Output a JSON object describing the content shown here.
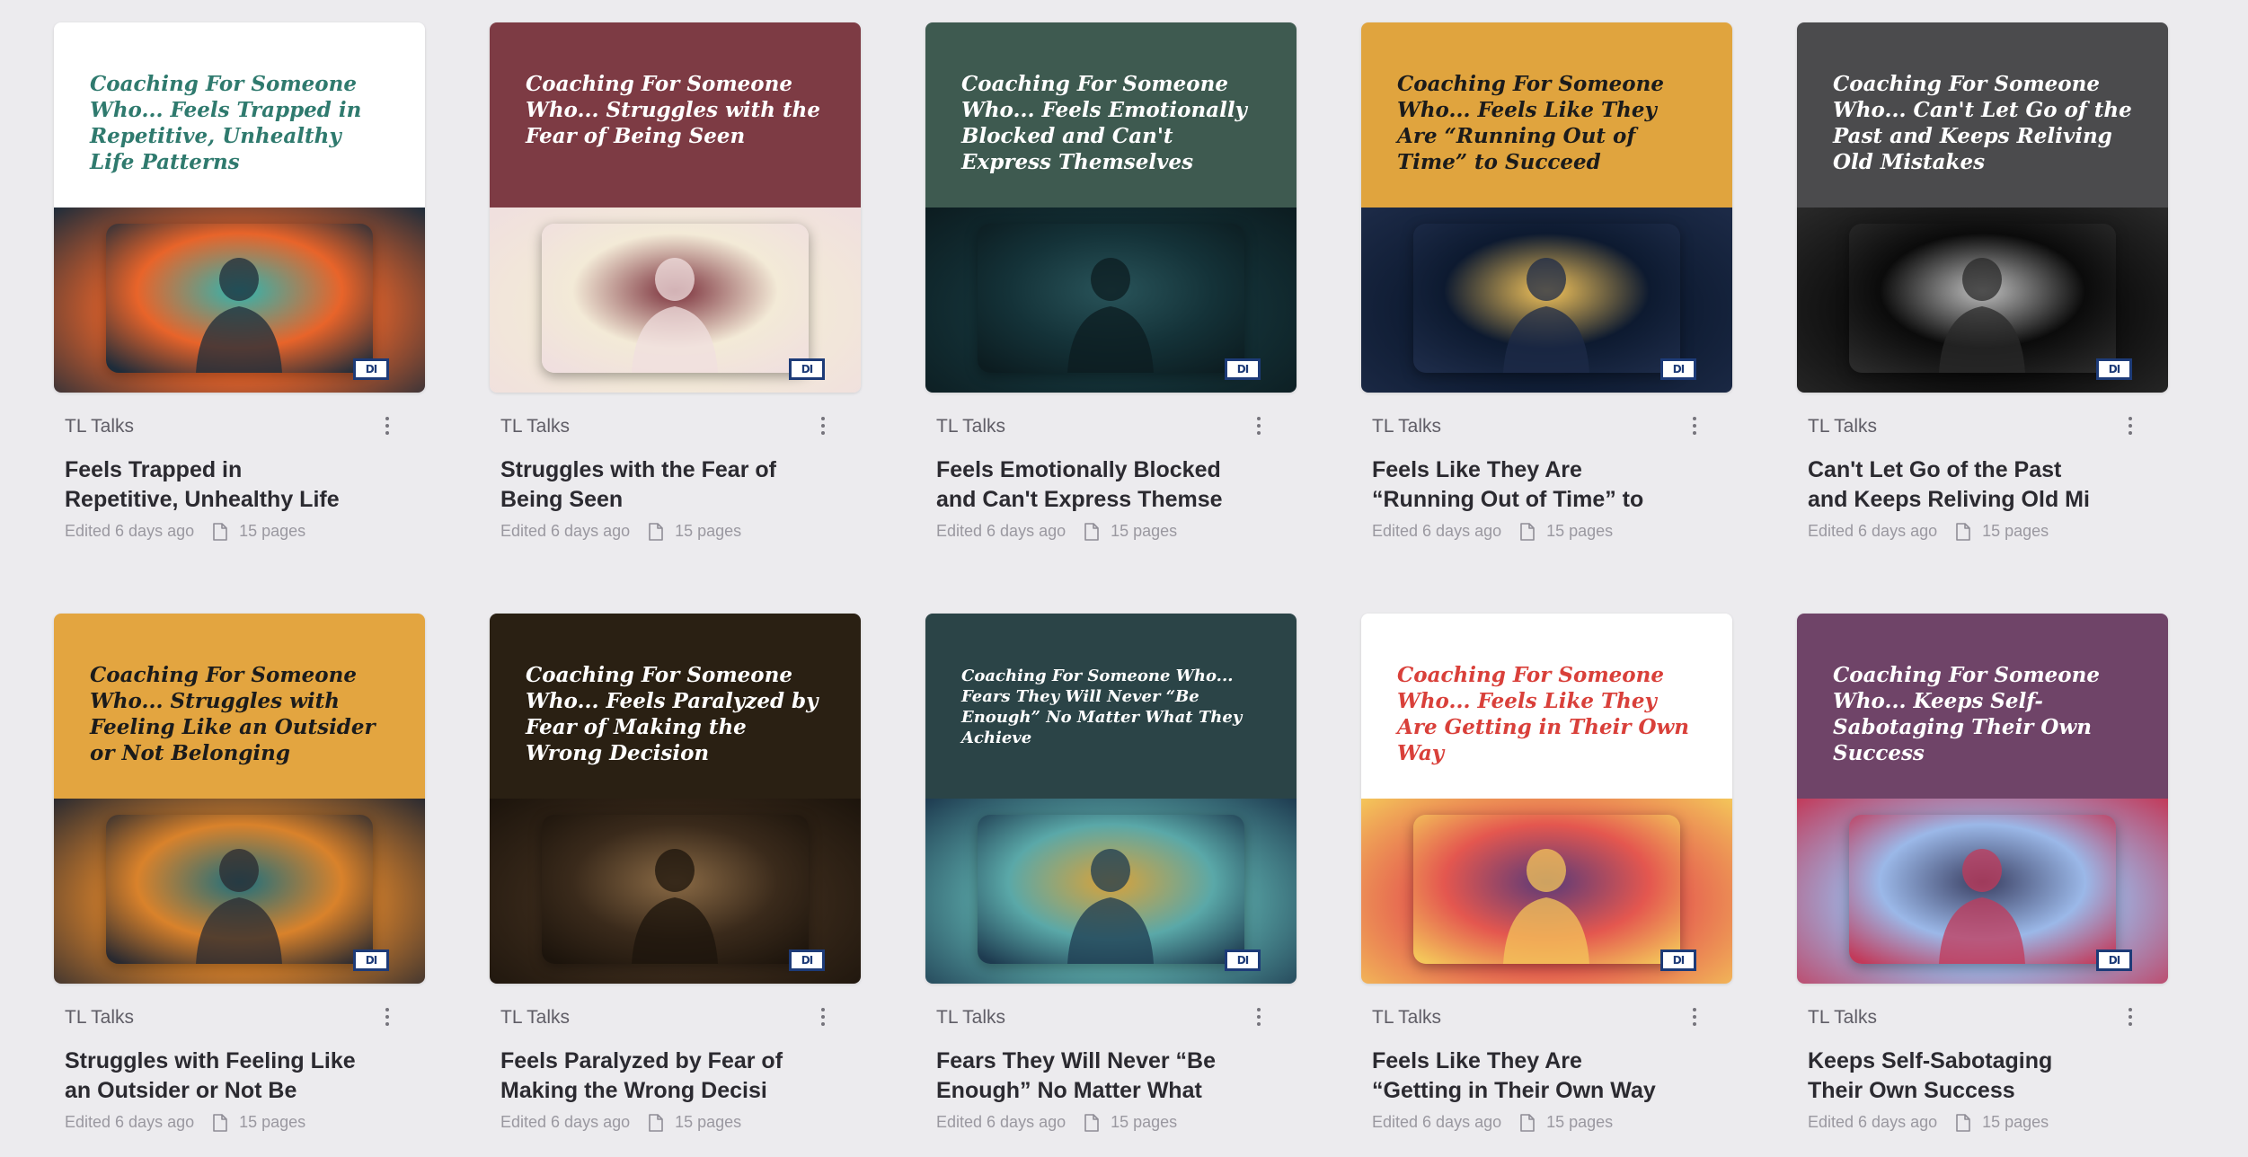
{
  "cards": [
    {
      "cover_text": "Coaching For Someone Who... Feels Trapped in Repetitive, Unhealthy Life Patterns",
      "cover_bg": "#ffffff",
      "cover_fg": "#2f7a6e",
      "art_colors": [
        "#e8642a",
        "#2fb5b0",
        "#1e2c3a"
      ],
      "art_icon": "boy-in-corridor-illustration",
      "logo_text": "DI",
      "channel": "TL Talks",
      "title": "Feels Trapped in Repetitive, Unhealthy Life Patter",
      "edited": "Edited 6 days ago",
      "pages": "15 pages"
    },
    {
      "cover_text": "Coaching For Someone Who... Struggles with the Fear of Being Seen",
      "cover_bg": "#7d3b44",
      "cover_fg": "#ffffff",
      "art_colors": [
        "#f3ead7",
        "#7a2f3a",
        "#f0dfdf"
      ],
      "art_icon": "stage-curtain-silhouette-illustration",
      "logo_text": "DI",
      "channel": "TL Talks",
      "title": "Struggles with the Fear of Being Seen",
      "edited": "Edited 6 days ago",
      "pages": "15 pages"
    },
    {
      "cover_text": "Coaching For Someone Who... Feels Emotionally Blocked and Can't Express Themselves",
      "cover_bg": "#3e5a50",
      "cover_fg": "#ffffff",
      "art_colors": [
        "#143238",
        "#29545a",
        "#0c1c20"
      ],
      "art_icon": "person-covering-face-photo",
      "logo_text": "DI",
      "channel": "TL Talks",
      "title": "Feels Emotionally Blocked and Can't Express Themse",
      "edited": "Edited 6 days ago",
      "pages": "15 pages"
    },
    {
      "cover_text": "Coaching For Someone Who... Feels Like They Are “Running Out of Time” to Succeed",
      "cover_bg": "#e0a43e",
      "cover_fg": "#1b1b1b",
      "art_colors": [
        "#0d1a30",
        "#f4c45a",
        "#1d2b48"
      ],
      "art_icon": "hourglass-door-illustration",
      "logo_text": "DI",
      "channel": "TL Talks",
      "title": "Feels Like They Are “Running Out of Time” to Succe",
      "edited": "Edited 6 days ago",
      "pages": "15 pages"
    },
    {
      "cover_text": "Coaching For Someone Who... Can't Let Go of the Past and Keeps Reliving Old Mistakes",
      "cover_bg": "#4b4b4d",
      "cover_fg": "#ffffff",
      "art_colors": [
        "#0b0b0b",
        "#bfbfbf",
        "#2a2a2a"
      ],
      "art_icon": "young-and-old-faces-photo",
      "logo_text": "DI",
      "channel": "TL Talks",
      "title": "Can't Let Go of the Past and Keeps Reliving Old Mi",
      "edited": "Edited 6 days ago",
      "pages": "15 pages"
    },
    {
      "cover_text": "Coaching For Someone Who... Struggles with Feeling Like an Outsider or Not Belonging",
      "cover_bg": "#e3a540",
      "cover_fg": "#1b1b1b",
      "art_colors": [
        "#d9822b",
        "#1d6f7e",
        "#2a2a30"
      ],
      "art_icon": "two-people-street-photo",
      "logo_text": "DI",
      "channel": "TL Talks",
      "title": "Struggles with Feeling Like an Outsider or Not Be",
      "edited": "Edited 6 days ago",
      "pages": "15 pages"
    },
    {
      "cover_text": "Coaching For Someone Who... Feels Paralyzed by Fear of Making the Wrong Decision",
      "cover_bg": "#2a2013",
      "cover_fg": "#ffffff",
      "art_colors": [
        "#3a2a1b",
        "#8a6a45",
        "#1c140c"
      ],
      "art_icon": "forest-crossroads-photo",
      "logo_text": "DI",
      "channel": "TL Talks",
      "title": "Feels Paralyzed by Fear of Making the Wrong Decisi",
      "edited": "Edited 6 days ago",
      "pages": "15 pages"
    },
    {
      "cover_text": "Coaching For Someone Who... Fears They Will Never “Be Enough” No Matter What They Achieve",
      "cover_bg": "#2b4447",
      "cover_fg": "#ffffff",
      "cover_small": true,
      "art_colors": [
        "#5aa8a8",
        "#d9a23a",
        "#1e3b50"
      ],
      "art_icon": "gold-trophies-clouds-illustration",
      "logo_text": "DI",
      "channel": "TL Talks",
      "title": "Fears They Will Never “Be Enough” No Matter What",
      "edited": "Edited 6 days ago",
      "pages": "15 pages"
    },
    {
      "cover_text": "Coaching For Someone Who... Feels Like They Are Getting in Their Own Way",
      "cover_bg": "#ffffff",
      "cover_fg": "#d9403a",
      "art_colors": [
        "#e4574f",
        "#5a3a78",
        "#f4c65a"
      ],
      "art_icon": "maze-mirror-illustration",
      "logo_text": "DI",
      "channel": "TL Talks",
      "title": "Feels Like They Are “Getting in Their Own Way",
      "edited": "Edited 6 days ago",
      "pages": "15 pages"
    },
    {
      "cover_text": "Coaching For Someone Who... Keeps Self-Sabotaging Their Own Success",
      "cover_bg": "#6f4468",
      "cover_fg": "#ffffff",
      "art_colors": [
        "#9bb8e8",
        "#3a3f62",
        "#c23a5a"
      ],
      "art_icon": "woman-at-desk-photo",
      "logo_text": "DI",
      "channel": "TL Talks",
      "title": "Keeps Self-Sabotaging Their Own Success",
      "edited": "Edited 6 days ago",
      "pages": "15 pages"
    }
  ]
}
